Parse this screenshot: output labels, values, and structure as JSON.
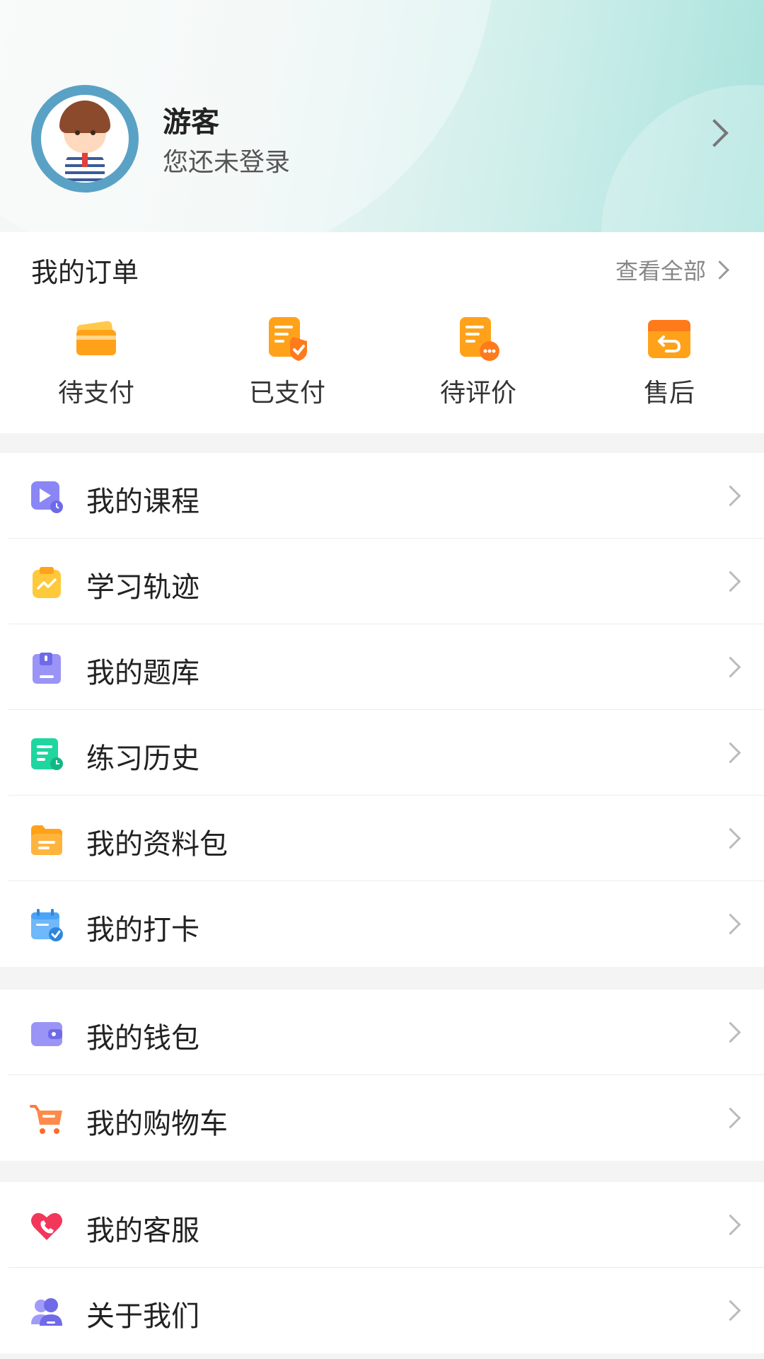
{
  "profile": {
    "name": "游客",
    "subtitle": "您还未登录"
  },
  "orders": {
    "title": "我的订单",
    "view_all": "查看全部",
    "items": [
      {
        "label": "待支付",
        "icon": "card-icon"
      },
      {
        "label": "已支付",
        "icon": "paid-doc-icon"
      },
      {
        "label": "待评价",
        "icon": "review-doc-icon"
      },
      {
        "label": "售后",
        "icon": "return-box-icon"
      }
    ]
  },
  "section1": [
    {
      "label": "我的课程",
      "icon": "course-play-icon"
    },
    {
      "label": "学习轨迹",
      "icon": "clipboard-chart-icon"
    },
    {
      "label": "我的题库",
      "icon": "question-bank-icon"
    },
    {
      "label": "练习历史",
      "icon": "practice-doc-icon"
    },
    {
      "label": "我的资料包",
      "icon": "folder-icon"
    },
    {
      "label": "我的打卡",
      "icon": "calendar-check-icon"
    }
  ],
  "section2": [
    {
      "label": "我的钱包",
      "icon": "wallet-icon"
    },
    {
      "label": "我的购物车",
      "icon": "cart-icon"
    }
  ],
  "section3": [
    {
      "label": "我的客服",
      "icon": "heart-phone-icon"
    },
    {
      "label": "关于我们",
      "icon": "users-icon"
    }
  ],
  "colors": {
    "orange": "#ffa21a",
    "purple": "#8a86f6",
    "yellow": "#ffc93c",
    "green": "#1fd6a0",
    "blue": "#4aa4f6",
    "red": "#f2375a",
    "header_teal": "#a9e2dc"
  }
}
